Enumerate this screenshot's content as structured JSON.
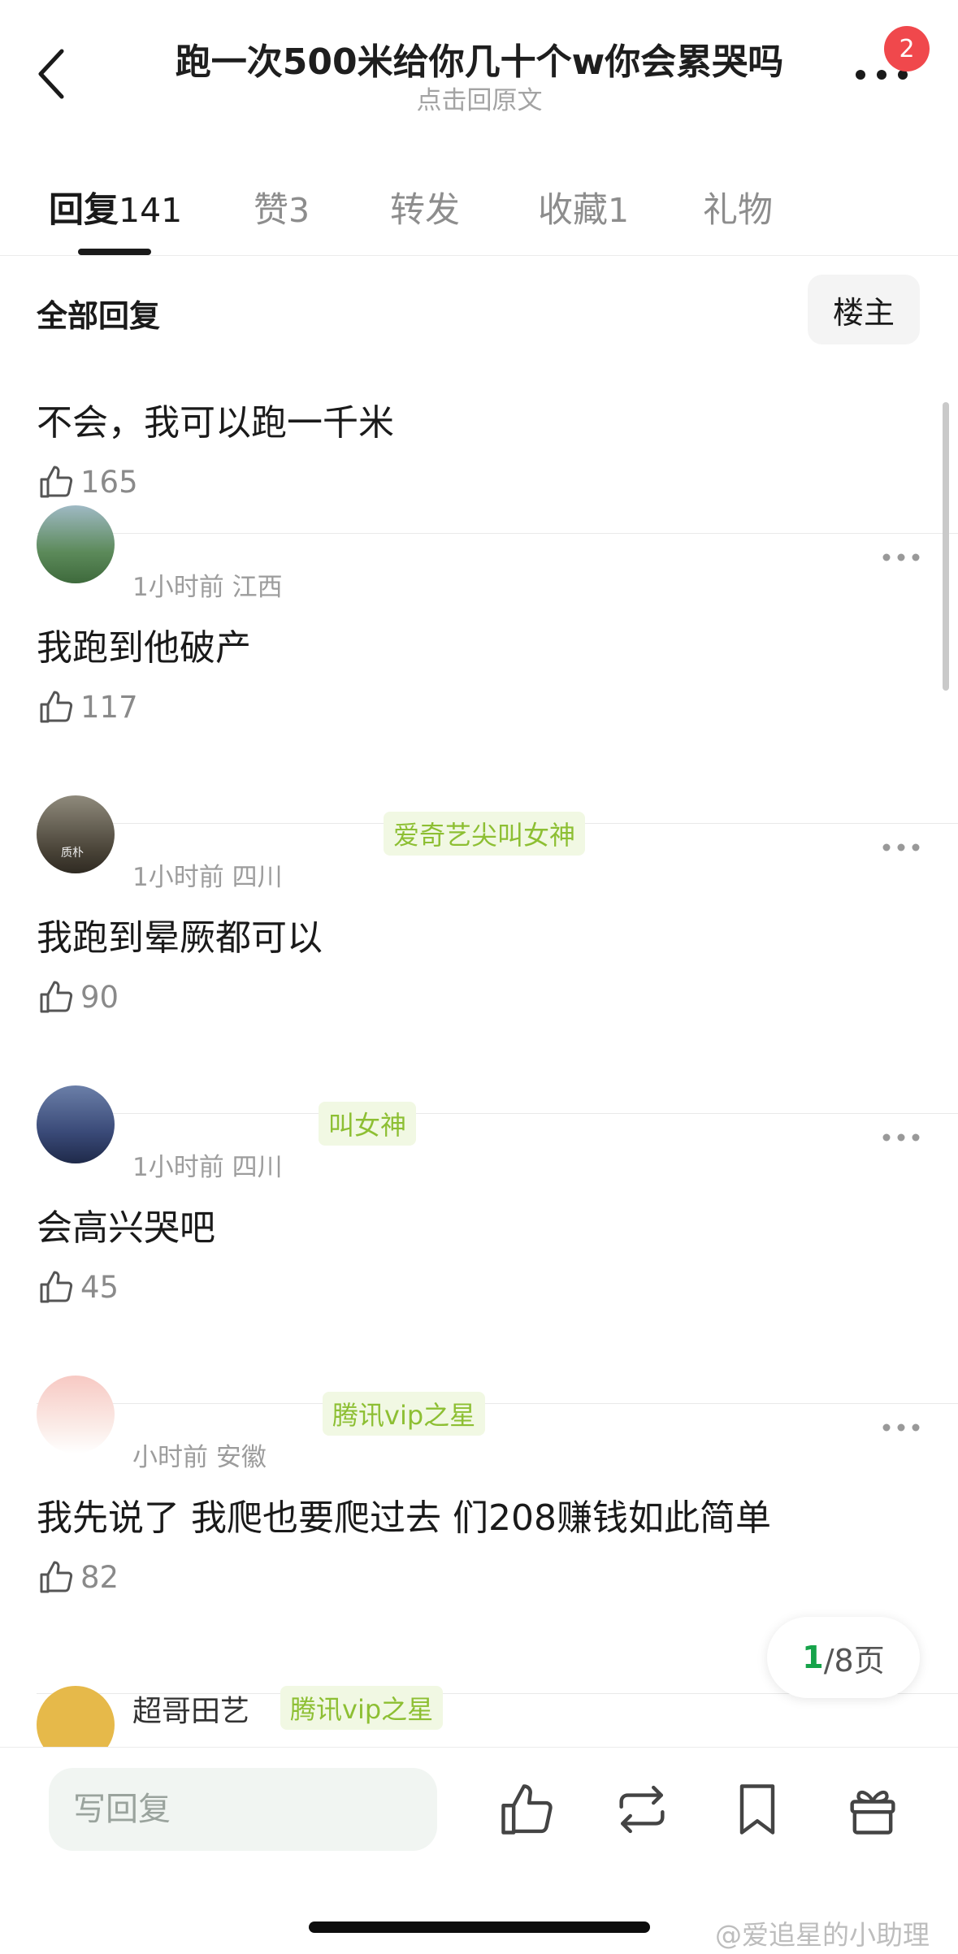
{
  "header": {
    "title": "跑一次500米给你几十个w你会累哭吗",
    "subtitle": "点击回原文",
    "notification_count": "2"
  },
  "tabs": [
    {
      "label": "回复",
      "count": "141"
    },
    {
      "label": "赞",
      "count": "3"
    },
    {
      "label": "转发",
      "count": ""
    },
    {
      "label": "收藏",
      "count": "1"
    },
    {
      "label": "礼物",
      "count": ""
    }
  ],
  "filter": {
    "label": "全部回复",
    "op_button": "楼主"
  },
  "comments": [
    {
      "text": "不会，我可以跑一千米",
      "likes": "165"
    },
    {
      "time": "1小时前",
      "location": "江西",
      "text": "我跑到他破产",
      "likes": "117"
    },
    {
      "badge": "爱奇艺尖叫女神",
      "time": "1小时前",
      "location": "四川",
      "text": "我跑到晕厥都可以",
      "likes": "90",
      "avatar_text": "质朴"
    },
    {
      "badge": "叫女神",
      "time": "1小时前",
      "location": "四川",
      "text": "会高兴哭吧",
      "likes": "45"
    },
    {
      "badge": "腾讯vip之星",
      "time": "小时前",
      "location": "安徽",
      "text": "我先说了 我爬也要爬过去 们208赚钱如此简单",
      "likes": "82"
    },
    {
      "name_partial": "超哥田艺",
      "badge_partial": "腾讯vip之星"
    }
  ],
  "pagination": {
    "current": "1",
    "total_text": "/8页"
  },
  "bottom_bar": {
    "reply_placeholder": "写回复"
  },
  "watermark": "@爱追星的小助理",
  "colors": {
    "badge_green": "#8dbf33",
    "page_green": "#16a34a",
    "notif_red": "#f0484c"
  }
}
